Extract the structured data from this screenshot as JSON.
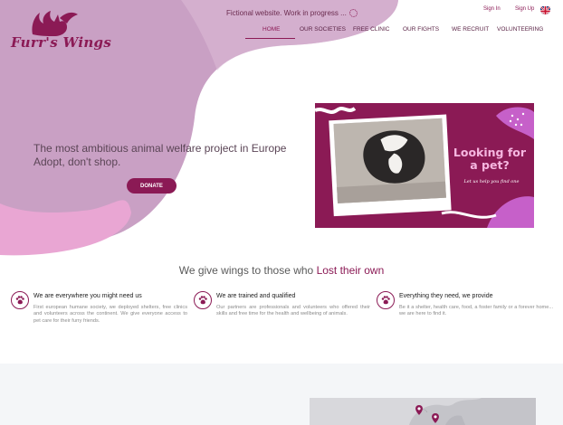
{
  "brand": {
    "name": "Furr's Wings",
    "color": "#8b1a55"
  },
  "header": {
    "notice": "Fictional website. Work in progress ...",
    "sign_in": "Sign In",
    "sign_up": "Sign Up",
    "language_icon": "uk-flag-icon"
  },
  "nav": {
    "items": [
      {
        "label": "HOME",
        "active": true
      },
      {
        "label": "OUR SOCIETIES",
        "active": false
      },
      {
        "label": "FREE CLINIC",
        "active": false
      },
      {
        "label": "OUR FIGHTS",
        "active": false
      },
      {
        "label": "WE RECRUIT",
        "active": false
      },
      {
        "label": "VOLUNTEERING",
        "active": false
      }
    ]
  },
  "hero": {
    "tagline_line1": "The most ambitious animal welfare project in Europe",
    "tagline_line2": "Adopt, don't shop.",
    "donate_label": "DONATE",
    "banner_title": "Looking for a pet?",
    "banner_subtitle": "Let us help you find one"
  },
  "mission": {
    "headline_prefix": "We give wings to those who ",
    "headline_accent": "Lost their own"
  },
  "features": [
    {
      "icon": "paw-icon",
      "title": "We are everywhere you might need us",
      "description": "First european humane society, we deployed shelters, free clinics and volunteers across the continent. We give everyone access to pet care for their furry friends."
    },
    {
      "icon": "paw-icon",
      "title": "We are trained and qualified",
      "description": "Our partners are professionals and volunteers who offered their skills and free time for the health and wellbeing of animals."
    },
    {
      "icon": "paw-icon",
      "title": "Everything they need, we provide",
      "description": "Be it a shelter, health care, food, a foster family or a forever home... we are here to find it."
    }
  ]
}
